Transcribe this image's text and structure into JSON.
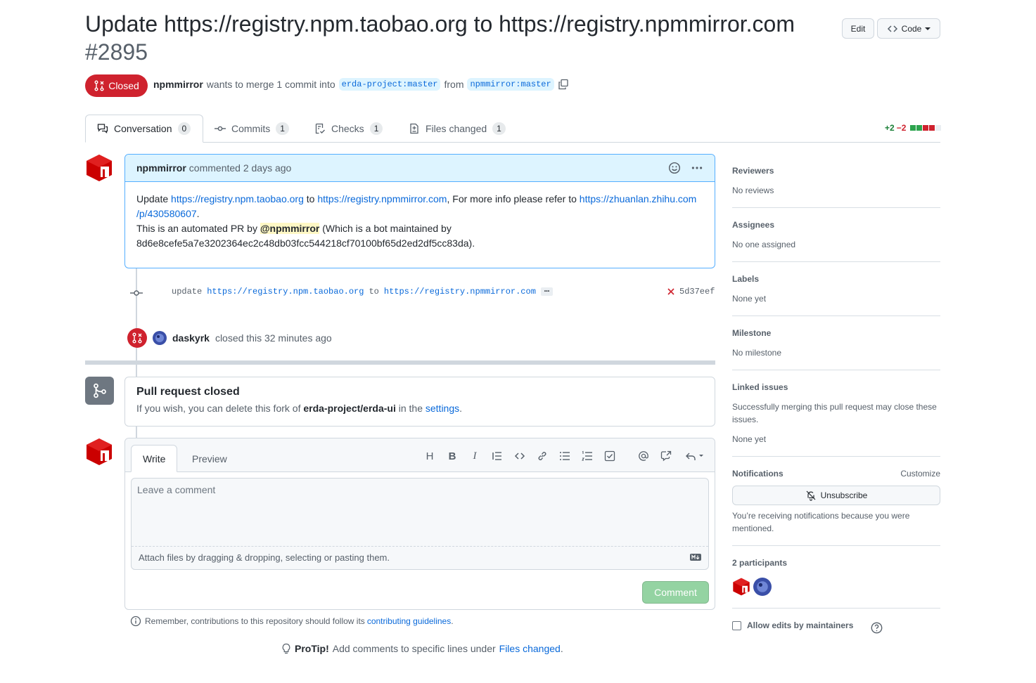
{
  "header": {
    "title": "Update https://registry.npm.taobao.org to https://registry.npmmirror.com",
    "number": "#2895",
    "edit_label": "Edit",
    "code_label": "Code"
  },
  "state": {
    "label": "Closed",
    "author": "npmmirror",
    "merge_text": "wants to merge 1 commit into",
    "base_branch": "erda-project:master",
    "from_text": "from",
    "head_branch": "npmmirror:master"
  },
  "tabs": [
    {
      "label": "Conversation",
      "count": "0"
    },
    {
      "label": "Commits",
      "count": "1"
    },
    {
      "label": "Checks",
      "count": "1"
    },
    {
      "label": "Files changed",
      "count": "1"
    }
  ],
  "diffstat": {
    "added": "+2",
    "removed": "−2"
  },
  "comment": {
    "author": "npmmirror",
    "meta": "commented 2 days ago",
    "body_update": "Update",
    "link1": "https://registry.npm.taobao.org",
    "to": "to",
    "link2": "https://registry.npmmirror.com",
    "more_info": ", For more info please refer to",
    "link3": "https://zhuanlan.zhihu.com",
    "link3b": "/p/430580607",
    "period": ".",
    "auto_pr": "This is an automated PR by",
    "mention": "@npmmirror",
    "bot_text": "(Which is a bot maintained by",
    "hash_line": "8d6e8cefe5a7e3202364ec2c48db03fcc544218cf70100bf65d2ed2df5cc83da)."
  },
  "commit": {
    "prefix": "update",
    "link1": "https://registry.npm.taobao.org",
    "to": "to",
    "link2": "https://registry.npmmirror.com",
    "toggle": "…",
    "sha": "5d37eef"
  },
  "closed_event": {
    "user": "daskyrk",
    "text": "closed this 32 minutes ago"
  },
  "merge_box": {
    "title": "Pull request closed",
    "desc_prefix": "If you wish, you can delete this fork of",
    "repo": "erda-project/erda-ui",
    "desc_mid": "in the",
    "settings_link": "settings",
    "period": "."
  },
  "composer": {
    "write_tab": "Write",
    "preview_tab": "Preview",
    "placeholder": "Leave a comment",
    "attach_text": "Attach files by dragging & dropping, selecting or pasting them.",
    "comment_button": "Comment",
    "tools": [
      "H",
      "B",
      "I"
    ]
  },
  "footer": {
    "remember_text": "Remember, contributions to this repository should follow its",
    "guidelines_link": "contributing guidelines",
    "period": ".",
    "protip_label": "ProTip!",
    "protip_text": "Add comments to specific lines under",
    "files_changed_link": "Files changed",
    "protip_period": "."
  },
  "sidebar": {
    "reviewers": {
      "title": "Reviewers",
      "value": "No reviews"
    },
    "assignees": {
      "title": "Assignees",
      "value": "No one assigned"
    },
    "labels": {
      "title": "Labels",
      "value": "None yet"
    },
    "milestone": {
      "title": "Milestone",
      "value": "No milestone"
    },
    "linked_issues": {
      "title": "Linked issues",
      "desc": "Successfully merging this pull request may close these issues.",
      "value": "None yet"
    },
    "notifications": {
      "title": "Notifications",
      "customize": "Customize",
      "button": "Unsubscribe",
      "desc": "You’re receiving notifications because you were mentioned."
    },
    "participants": {
      "title": "2 participants"
    },
    "allow_edits": "Allow edits by maintainers"
  },
  "colors": {
    "accent": "#0969da",
    "closed": "#cf222e",
    "added": "#1a7f37",
    "removed": "#cf222e"
  }
}
